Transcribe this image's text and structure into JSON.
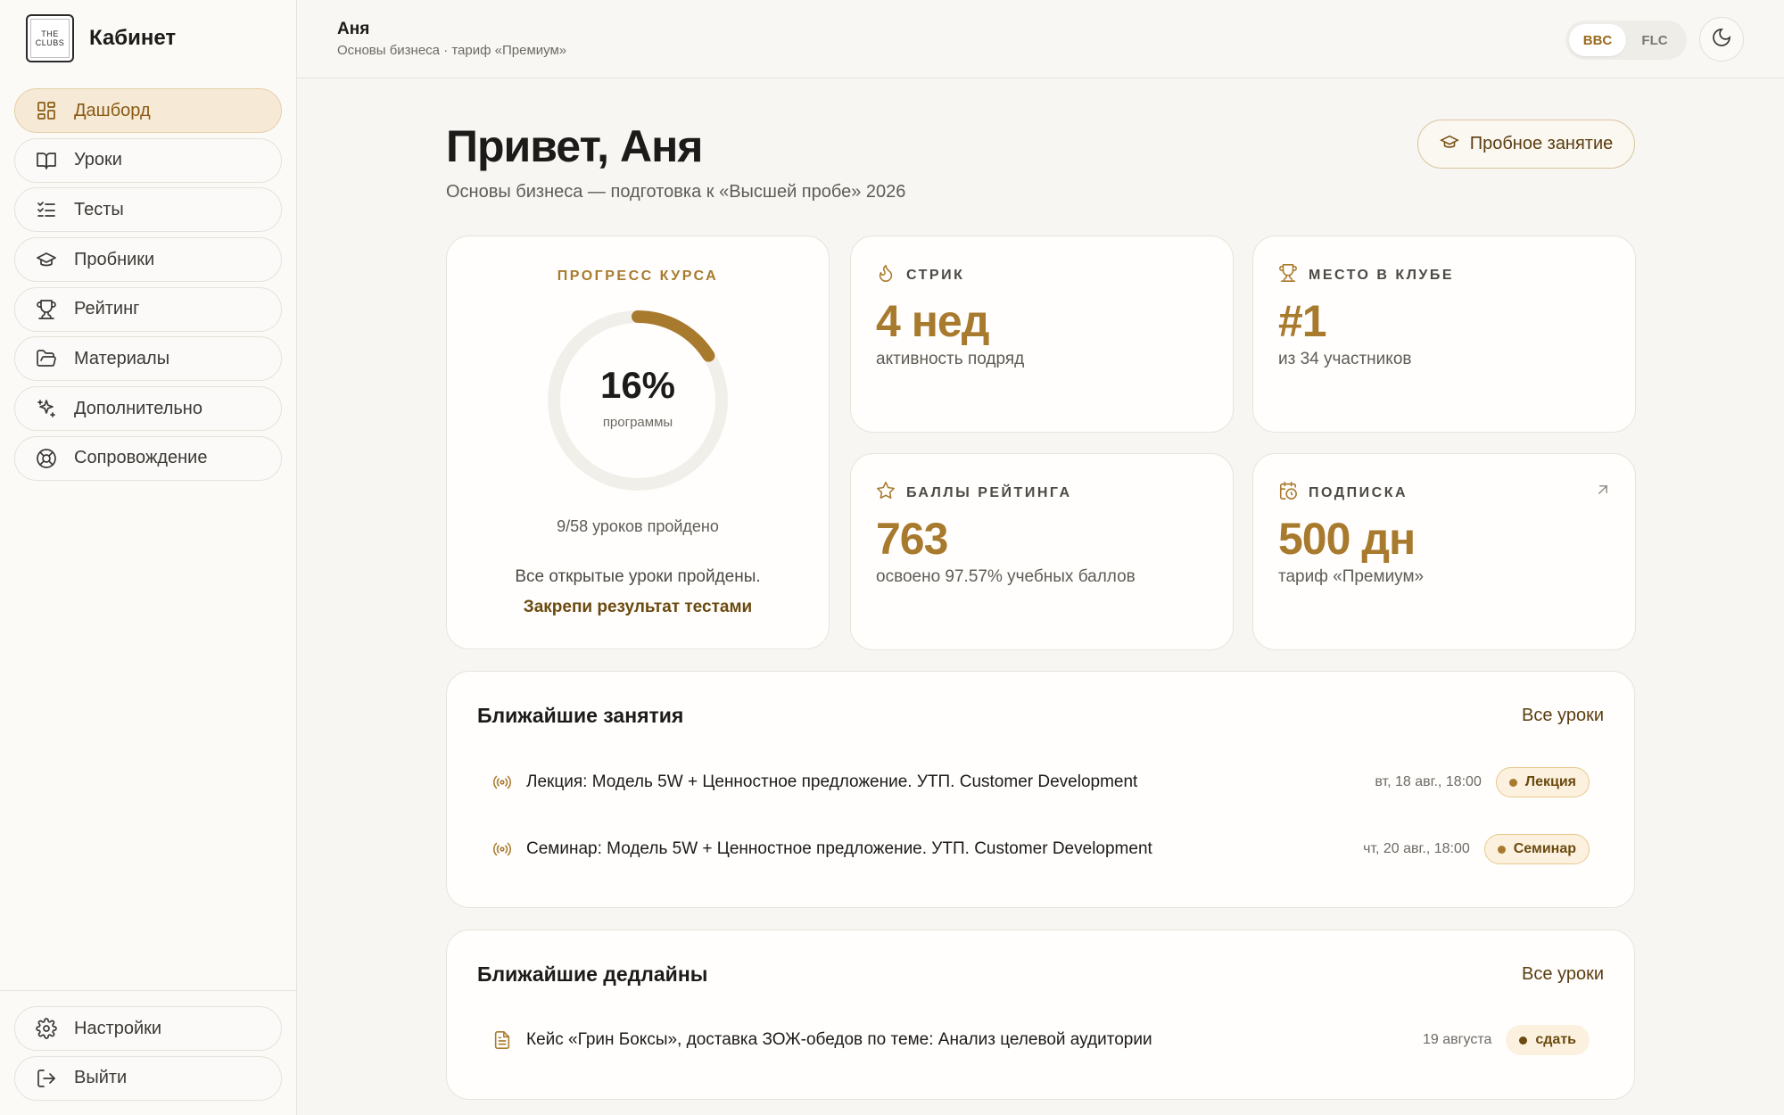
{
  "brand": {
    "logo_line1": "THE",
    "logo_line2": "CLUBS",
    "title": "Кабинет"
  },
  "sidebar": {
    "items": [
      {
        "label": "Дашборд",
        "icon": "dashboard-icon",
        "active": true
      },
      {
        "label": "Уроки",
        "icon": "book-icon"
      },
      {
        "label": "Тесты",
        "icon": "checklist-icon"
      },
      {
        "label": "Пробники",
        "icon": "graduation-cap-icon"
      },
      {
        "label": "Рейтинг",
        "icon": "trophy-icon"
      },
      {
        "label": "Материалы",
        "icon": "folder-icon"
      },
      {
        "label": "Дополнительно",
        "icon": "sparkles-icon"
      },
      {
        "label": "Сопровождение",
        "icon": "lifebuoy-icon"
      }
    ],
    "bottom": [
      {
        "label": "Настройки",
        "icon": "gear-icon"
      },
      {
        "label": "Выйти",
        "icon": "logout-icon"
      }
    ]
  },
  "header": {
    "user_name": "Аня",
    "user_sub": "Основы бизнеса · тариф «Премиум»",
    "segments": [
      "BBC",
      "FLC"
    ],
    "active_segment": "BBC",
    "theme_icon": "moon-icon"
  },
  "main": {
    "greeting": "Привет, Аня",
    "subtitle": "Основы бизнеса — подготовка к «Высшей пробе» 2026",
    "trial_button": "Пробное занятие"
  },
  "progress": {
    "title": "ПРОГРЕСС КУРСА",
    "percent": 16,
    "percent_label": "16%",
    "percent_caption": "программы",
    "lessons": "9/58 уроков пройдено",
    "message": "Все открытые уроки пройдены.",
    "link": "Закрепи результат тестами"
  },
  "stats": {
    "streak": {
      "label": "СТРИК",
      "value": "4 нед",
      "sub": "активность подряд",
      "icon": "flame-icon"
    },
    "place": {
      "label": "МЕСТО В КЛУБЕ",
      "value": "#1",
      "sub": "из 34 участников",
      "icon": "trophy-icon"
    },
    "points": {
      "label": "БАЛЛЫ РЕЙТИНГА",
      "value": "763",
      "sub": "освоено 97.57% учебных баллов",
      "icon": "star-icon"
    },
    "subscription": {
      "label": "ПОДПИСКА",
      "value": "500 дн",
      "sub": "тариф «Премиум»",
      "icon": "calendar-clock-icon"
    }
  },
  "upcoming": {
    "title": "Ближайшие занятия",
    "link": "Все уроки",
    "rows": [
      {
        "title": "Лекция: Модель 5W + Ценностное предложение. УТП. Customer Development",
        "date": "вт, 18 авг., 18:00",
        "badge": "Лекция"
      },
      {
        "title": "Семинар: Модель 5W + Ценностное предложение. УТП. Customer Development",
        "date": "чт, 20 авг., 18:00",
        "badge": "Семинар"
      }
    ]
  },
  "deadlines": {
    "title": "Ближайшие дедлайны",
    "link": "Все уроки",
    "rows": [
      {
        "title": "Кейс «Грин Боксы», доставка ЗОЖ-обедов по теме: Анализ целевой аудитории",
        "date": "19 августа",
        "badge": "сдать"
      }
    ]
  },
  "colors": {
    "accent": "#a87a2e",
    "accent_dark": "#6b4a10",
    "background": "#f7f6f2",
    "active_nav": "#f6ead7"
  }
}
